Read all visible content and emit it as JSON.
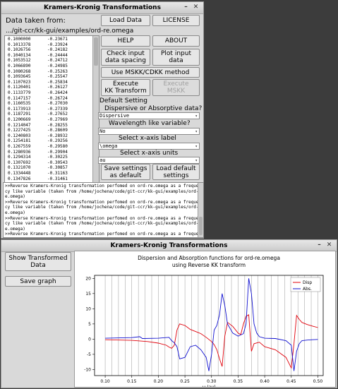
{
  "main_window": {
    "title": "Kramers-Kronig Transformations",
    "data_taken_from_label": "Data taken from:",
    "file_path": ".../git-ccr/kk-gui/examples/ord-re.omega",
    "data_rows": [
      [
        "0.1000000",
        "-0.23671"
      ],
      [
        "0.1013378",
        "-0.23924"
      ],
      [
        "0.1026756",
        "-0.24182"
      ],
      [
        "0.1040134",
        "-0.24444"
      ],
      [
        "0.1053512",
        "-0.24712"
      ],
      [
        "0.1066890",
        "-0.24985"
      ],
      [
        "0.1080268",
        "-0.25263"
      ],
      [
        "0.1093645",
        "-0.25547"
      ],
      [
        "0.1107023",
        "-0.25834"
      ],
      [
        "0.1120401",
        "-0.26127"
      ],
      [
        "0.1133779",
        "-0.26424"
      ],
      [
        "0.1147157",
        "-0.26724"
      ],
      [
        "0.1160535",
        "-0.27030"
      ],
      [
        "0.1173913",
        "-0.27339"
      ],
      [
        "0.1187291",
        "-0.27652"
      ],
      [
        "0.1200669",
        "-0.27969"
      ],
      [
        "0.1214047",
        "-0.28255"
      ],
      [
        "0.1227425",
        "-0.28609"
      ],
      [
        "0.1240803",
        "-0.28932"
      ],
      [
        "0.1254181",
        "-0.29256"
      ],
      [
        "0.1267559",
        "-0.29580"
      ],
      [
        "0.1280936",
        "-0.29904"
      ],
      [
        "0.1294314",
        "-0.30225"
      ],
      [
        "0.1307692",
        "-0.30543"
      ],
      [
        "0.1321070",
        "-0.30857"
      ],
      [
        "0.1334448",
        "-0.31163"
      ],
      [
        "0.1347826",
        "-0.31461"
      ]
    ],
    "buttons": {
      "load_data": "Load Data",
      "license": "LICENSE",
      "help": "HELP",
      "about": "ABOUT",
      "check_input_spacing": "Check input\ndata spacing",
      "plot_input_data": "Plot input\ndata",
      "use_mskk": "Use MSKK/CDKK method",
      "execute_kk": "Execute\nKK Transform",
      "execute_mskk": "Execute\nMSKK",
      "save_settings": "Save settings\nas default",
      "load_default": "Load default\nsettings"
    },
    "default_setting_label": "Default Setting",
    "dispersive_question": "Dispersive or Absorptive data?",
    "dispersive_value": "Dispersive",
    "wavelength_question": "Wavelength like variable?",
    "wavelength_value": "No",
    "xaxis_label_prompt": "Select x-axis label",
    "xaxis_label_value": "\\omega",
    "xaxis_units_prompt": "Select x-axis units",
    "xaxis_units_value": "au",
    "log_lines": [
      ">>Reverse Kramers-Kronig transformation perfomed on ord-re.omega as a frequen",
      "cy like variable (taken from /home/jochena/code/git-ccr/kk-gui/examples/ord-r",
      "e.omega)",
      ">>Reverse Kramers-Kronig transformation perfomed on ord-re.omega as a frequen",
      "cy like variable (taken from /home/jochena/code/git-ccr/kk-gui/examples/ord-r",
      "e.omega)",
      ">>Reverse Kramers-Kronig transformation perfomed on ord-re.omega as a frequen",
      "cy like variable (taken from /home/jochena/code/git-ccr/kk-gui/examples/ord-r",
      "e.omega)",
      ">>Reverse Kramers-Kronig transformation perfomed on ord-re.omega as a frequen"
    ]
  },
  "plot_window": {
    "title": "Kramers-Kronig Transformations",
    "show_transformed": "Show Transformed\nData",
    "save_graph": "Save graph"
  },
  "chart_data": {
    "type": "line",
    "title": "Dispersion and Absorption functions for ord-re.omega\nusing Reverse KK transform",
    "xlabel": "ω (au)",
    "ylabel": "",
    "xlim": [
      0.08,
      0.51
    ],
    "ylim": [
      -12,
      21
    ],
    "xticks": [
      "0.10",
      "0.15",
      "0.20",
      "0.25",
      "0.30",
      "0.35",
      "0.40",
      "0.45",
      "0.50"
    ],
    "yticks": [
      "20",
      "15",
      "10",
      "5",
      "0",
      "-5",
      "-10"
    ],
    "grid": "vertical",
    "legend_placement": "top-right",
    "colors": {
      "disp": "#e0000a",
      "abs": "#1010d0"
    },
    "series": [
      {
        "name": "Disp",
        "x": [
          0.1,
          0.15,
          0.165,
          0.18,
          0.2,
          0.215,
          0.22,
          0.225,
          0.23,
          0.235,
          0.24,
          0.25,
          0.26,
          0.27,
          0.28,
          0.29,
          0.3,
          0.305,
          0.31,
          0.315,
          0.32,
          0.325,
          0.33,
          0.34,
          0.35,
          0.355,
          0.36,
          0.365,
          0.37,
          0.375,
          0.38,
          0.39,
          0.4,
          0.42,
          0.44,
          0.45,
          0.455,
          0.46,
          0.465,
          0.47,
          0.48,
          0.49,
          0.5
        ],
        "values": [
          -0.2,
          -0.4,
          -0.6,
          -0.8,
          -1.3,
          -2.0,
          -2.6,
          -3.0,
          -2.0,
          3.0,
          5.0,
          4.5,
          3.2,
          2.5,
          1.8,
          0.6,
          -0.8,
          -1.8,
          -3.5,
          -6.5,
          -9.0,
          1.0,
          5.5,
          4.2,
          2.0,
          1.5,
          5.0,
          7.5,
          8.0,
          -4.0,
          -1.5,
          -1.0,
          -2.5,
          -3.5,
          -6.0,
          -9.5,
          -1.5,
          7.8,
          6.5,
          5.5,
          4.8,
          4.3,
          3.8
        ]
      },
      {
        "name": "Abs.",
        "x": [
          0.1,
          0.15,
          0.165,
          0.17,
          0.2,
          0.22,
          0.225,
          0.23,
          0.235,
          0.24,
          0.25,
          0.26,
          0.27,
          0.28,
          0.29,
          0.295,
          0.3,
          0.305,
          0.31,
          0.315,
          0.32,
          0.325,
          0.33,
          0.34,
          0.35,
          0.36,
          0.365,
          0.37,
          0.375,
          0.38,
          0.385,
          0.39,
          0.4,
          0.42,
          0.44,
          0.45,
          0.455,
          0.46,
          0.465,
          0.47,
          0.48,
          0.49,
          0.5
        ],
        "values": [
          0.3,
          0.5,
          0.8,
          0.2,
          0.3,
          0.6,
          -0.5,
          -1.2,
          -2.5,
          -6.5,
          -6.0,
          -2.5,
          -2.0,
          -3.5,
          -6.0,
          -10.5,
          -5.0,
          3.0,
          4.5,
          8.0,
          15.0,
          11.0,
          5.0,
          2.0,
          1.0,
          1.8,
          5.0,
          20.0,
          15.0,
          5.0,
          2.0,
          0.8,
          0.3,
          0.2,
          -0.5,
          -2.0,
          -10.5,
          -4.0,
          -1.5,
          -0.5,
          -0.3,
          -0.2,
          -0.1
        ]
      }
    ]
  }
}
